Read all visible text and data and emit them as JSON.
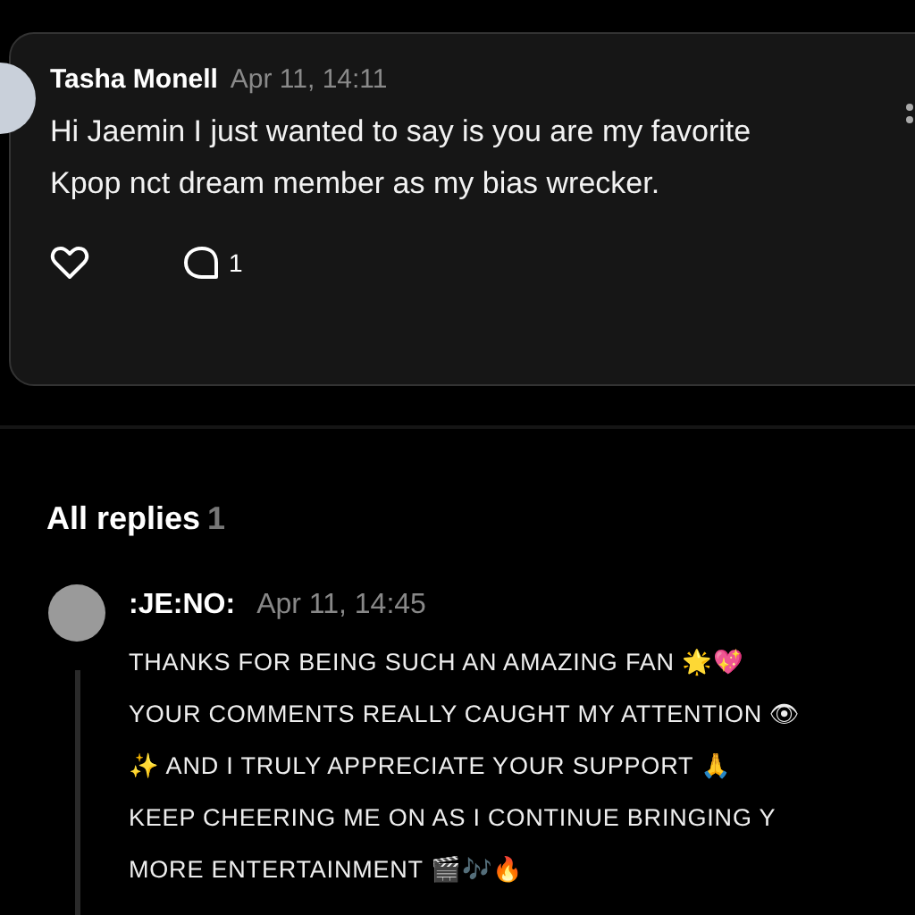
{
  "comment": {
    "author": "Tasha Monell",
    "time": "Apr 11, 14:11",
    "text": "Hi Jaemin I just wanted to say is you are my favorite Kpop nct dream member as my bias wrecker.",
    "reply_count": "1"
  },
  "replies_header": {
    "title": "All replies",
    "count": "1"
  },
  "replies": [
    {
      "author": ":JE:NO:",
      "time": "Apr 11, 14:45",
      "lines": [
        "THANKS FOR BEING SUCH AN AMAZING FAN 🌟💖",
        "YOUR COMMENTS REALLY CAUGHT MY ATTENTION 👁",
        "✨ AND I TRULY APPRECIATE YOUR SUPPORT 🙏",
        "KEEP CHEERING ME ON AS I CONTINUE BRINGING Y",
        "MORE ENTERTAINMENT 🎬🎶🔥"
      ]
    }
  ]
}
